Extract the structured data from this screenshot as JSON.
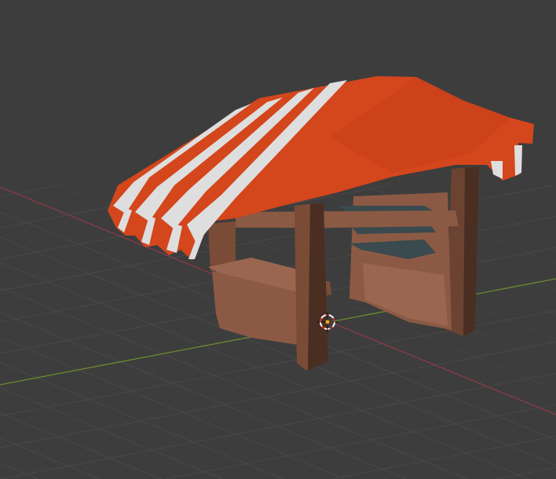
{
  "viewport": {
    "mode": "3d-viewport",
    "background": "#3d3d3d",
    "grid_color": "#4a4a4a",
    "x_axis_color": "#8a3a48",
    "y_axis_color": "#6a8a2e"
  },
  "model": {
    "name_icon": "market-stall-model",
    "roof_color": "#d4461c",
    "stripe_color": "#dcdcdc",
    "wood_color": "#8a5a44",
    "post_color": "#5e3a2a",
    "shelf_color": "#3a4a4e"
  },
  "cursor": {
    "icon": "3d-cursor-icon"
  }
}
